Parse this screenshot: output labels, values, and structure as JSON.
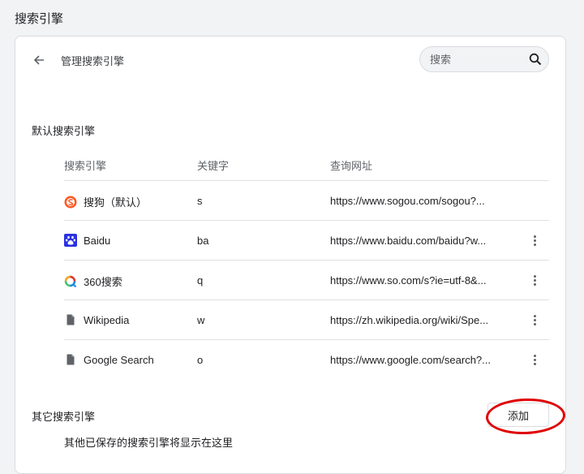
{
  "page": {
    "title": "搜索引擎"
  },
  "header": {
    "subtitle": "管理搜索引擎",
    "search_placeholder": "搜索"
  },
  "default_section": {
    "label": "默认搜索引擎",
    "columns": [
      "搜索引擎",
      "关键字",
      "查询网址"
    ],
    "rows": [
      {
        "name": "搜狗（默认）",
        "keyword": "s",
        "url": "https://www.sogou.com/sogou?...",
        "icon": "sogou-icon",
        "has_menu": false
      },
      {
        "name": "Baidu",
        "keyword": "ba",
        "url": "https://www.baidu.com/baidu?w...",
        "icon": "baidu-icon",
        "has_menu": true
      },
      {
        "name": "360搜索",
        "keyword": "q",
        "url": "https://www.so.com/s?ie=utf-8&...",
        "icon": "360-icon",
        "has_menu": true
      },
      {
        "name": "Wikipedia",
        "keyword": "w",
        "url": "https://zh.wikipedia.org/wiki/Spe...",
        "icon": "document-icon",
        "has_menu": true
      },
      {
        "name": "Google Search",
        "keyword": "o",
        "url": "https://www.google.com/search?...",
        "icon": "document-icon",
        "has_menu": true
      }
    ]
  },
  "other_section": {
    "label": "其它搜索引擎",
    "add_label": "添加",
    "empty_text": "其他已保存的搜索引擎将显示在这里"
  },
  "colors": {
    "highlight": "#e00000",
    "sogou": "#ff5722",
    "baidu": "#2932e1"
  }
}
